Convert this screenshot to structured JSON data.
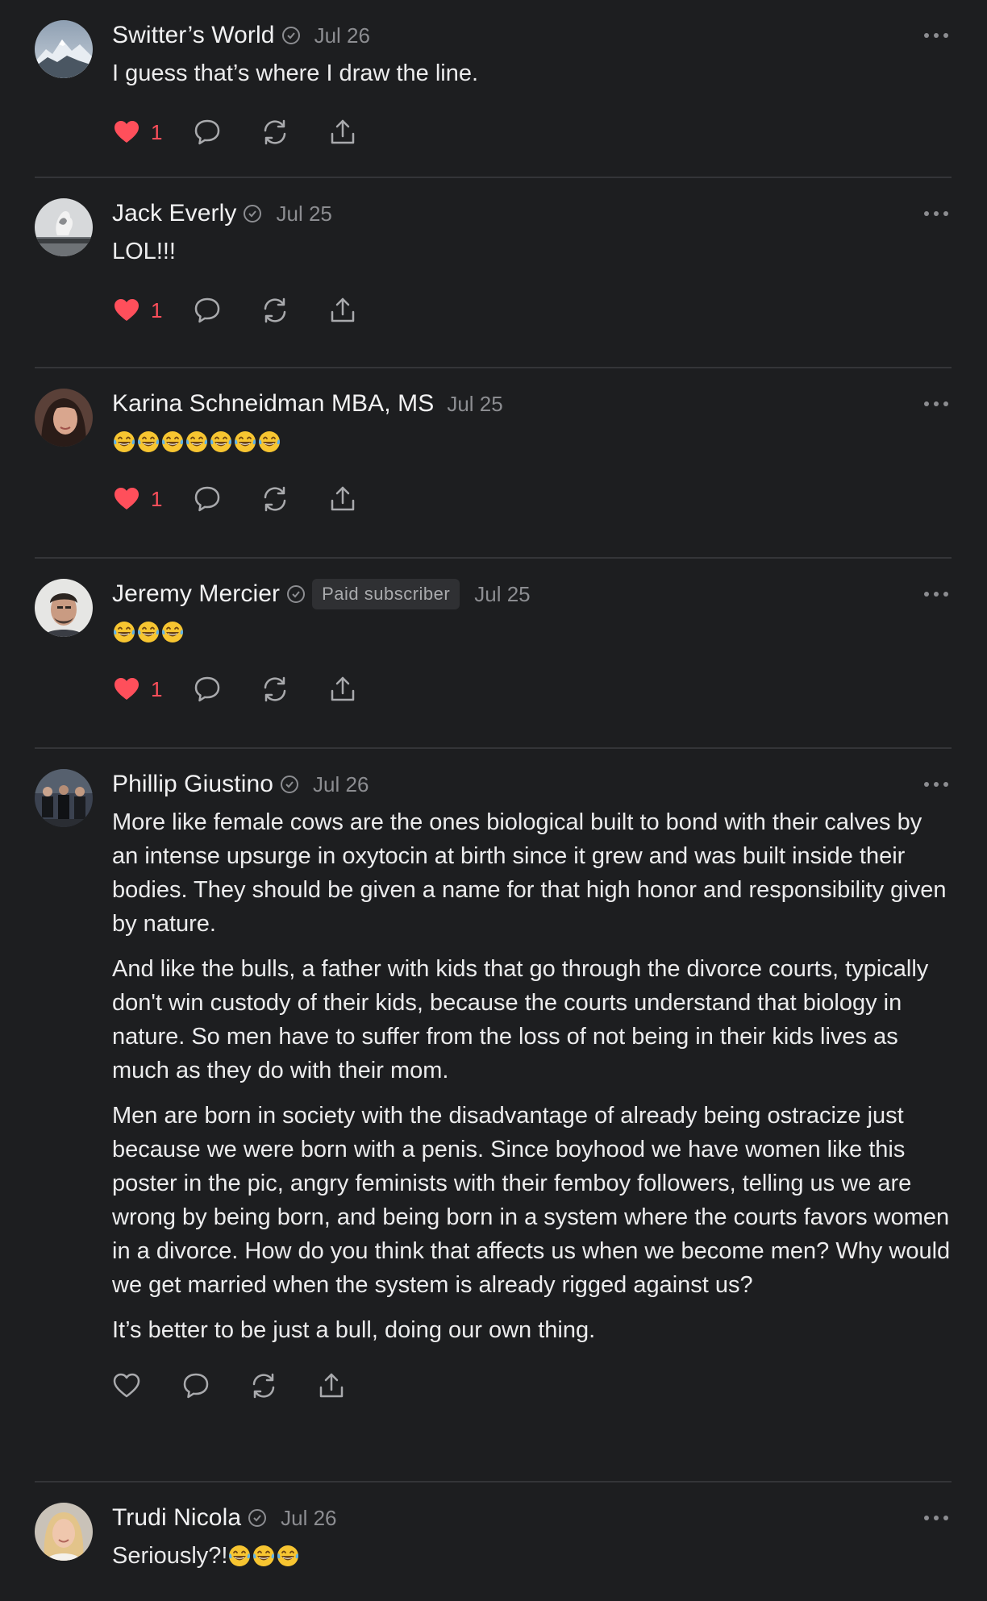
{
  "colors": {
    "background": "#1d1e20",
    "divider": "#343538",
    "like_active": "#ff4f5b",
    "muted": "#8c8d91"
  },
  "comments": [
    {
      "author": "Switter’s World",
      "verified": true,
      "date": "Jul 26",
      "paragraphs": [
        "I guess that’s where I draw the line."
      ],
      "emoji": [],
      "liked": true,
      "like_count": "1",
      "avatar_icon": "mountain-avatar"
    },
    {
      "author": "Jack Everly",
      "verified": true,
      "date": "Jul 25",
      "paragraphs": [
        "LOL!!!"
      ],
      "emoji": [],
      "liked": true,
      "like_count": "1",
      "avatar_icon": "eruption-avatar"
    },
    {
      "author": "Karina Schneidman MBA, MS",
      "verified": false,
      "date": "Jul 25",
      "paragraphs": [],
      "emoji": [
        "face-with-tears-of-joy",
        "face-with-tears-of-joy",
        "face-with-tears-of-joy",
        "face-with-tears-of-joy",
        "face-with-tears-of-joy",
        "face-with-tears-of-joy",
        "face-with-tears-of-joy"
      ],
      "liked": true,
      "like_count": "1",
      "avatar_icon": "woman-portrait-avatar"
    },
    {
      "author": "Jeremy Mercier",
      "verified": true,
      "badge": "Paid subscriber",
      "date": "Jul 25",
      "paragraphs": [],
      "emoji": [
        "face-with-tears-of-joy",
        "face-with-tears-of-joy",
        "face-with-tears-of-joy"
      ],
      "liked": true,
      "like_count": "1",
      "avatar_icon": "man-portrait-avatar"
    },
    {
      "author": "Phillip Giustino",
      "verified": true,
      "date": "Jul 26",
      "paragraphs": [
        "More like female cows are the ones biological built to bond with their calves by an intense upsurge in oxytocin at birth since it grew and was built inside their bodies. They should be given a name for that high honor and responsibility given by nature.",
        "And like the bulls, a father with kids that go through the divorce courts, typically don't win custody of their kids, because the courts understand that biology in nature. So men have to suffer from the loss of not being in their kids lives as much as they do with their mom.",
        "Men are born in society with the disadvantage of already being ostracize just because we were born with a penis. Since boyhood we have women like this poster in the pic, angry feminists with their femboy followers, telling us we are wrong by being born, and being born in a system where the courts favors women in a divorce. How do you think that affects us when we become men? Why would we get married when the system is already rigged against us?",
        "It’s better to be just a bull, doing our own thing."
      ],
      "emoji": [],
      "liked": false,
      "like_count": "",
      "avatar_icon": "group-photo-avatar"
    },
    {
      "author": "Trudi Nicola",
      "verified": true,
      "date": "Jul 26",
      "text_before_emoji": "Seriously?!",
      "paragraphs": [],
      "emoji": [
        "face-with-tears-of-joy",
        "face-with-tears-of-joy",
        "face-with-tears-of-joy"
      ],
      "liked": false,
      "like_count": "",
      "avatar_icon": "blonde-woman-avatar"
    }
  ]
}
